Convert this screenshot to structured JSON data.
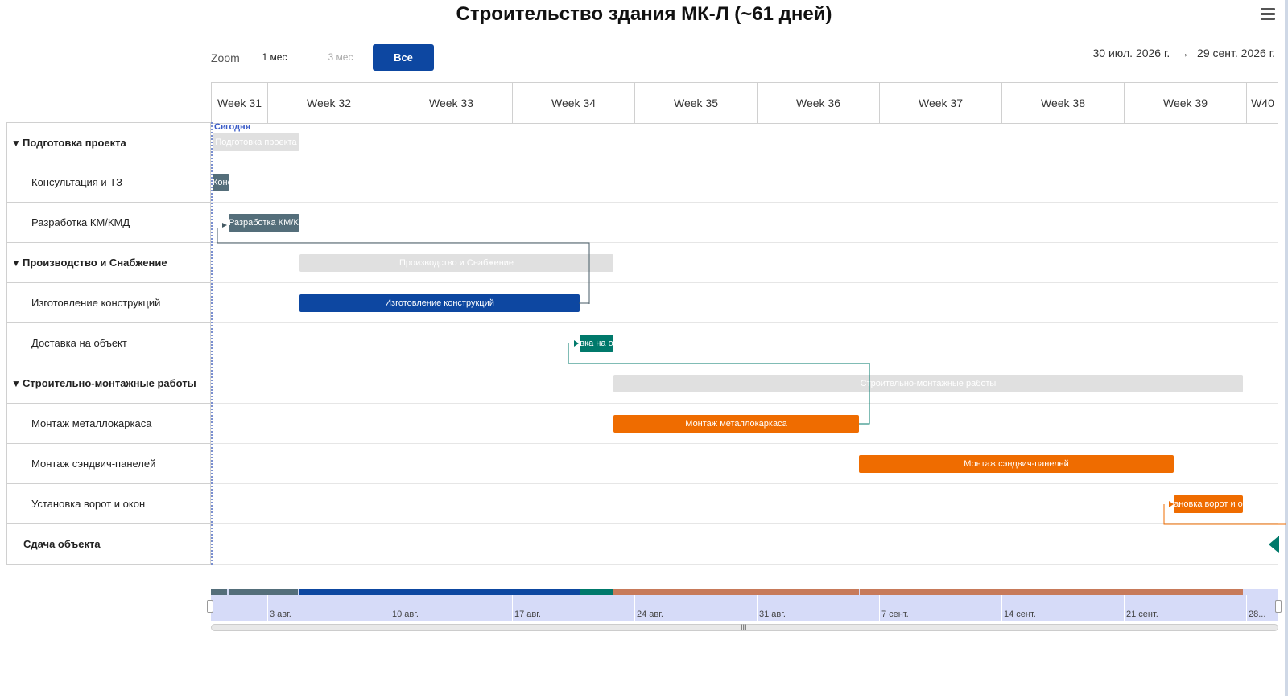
{
  "title": "Строительство здания МК-Л (~61 дней)",
  "menu_icon": "hamburger-menu-icon",
  "zoom": {
    "label": "Zoom",
    "options": [
      "1 мес",
      "3 мес",
      "Все"
    ],
    "selected": "Все"
  },
  "date_range": {
    "start": "30 июл. 2026 г.",
    "arrow": "→",
    "end": "29 сент. 2026 г."
  },
  "weeks": [
    "Week 31",
    "Week 32",
    "Week 33",
    "Week 34",
    "Week 35",
    "Week 36",
    "Week 37",
    "Week 38",
    "Week 39",
    "W40"
  ],
  "today_label": "Сегодня",
  "rows": [
    {
      "label": "Подготовка проекта",
      "kind": "group",
      "collapse_icon": "triangle-down-icon",
      "bar_label": "Подготовка проекта"
    },
    {
      "label": "Консультация и ТЗ",
      "kind": "task",
      "bar_label": "Конс"
    },
    {
      "label": "Разработка КМ/КМД",
      "kind": "task",
      "bar_label": "Разработка КМ/КМ"
    },
    {
      "label": "Производство и Снабжение",
      "kind": "group",
      "collapse_icon": "triangle-down-icon",
      "bar_label": "Производство и Снабжение"
    },
    {
      "label": "Изготовление конструкций",
      "kind": "task",
      "bar_label": "Изготовление конструкций"
    },
    {
      "label": "Доставка на объект",
      "kind": "task",
      "bar_label": "вка на о"
    },
    {
      "label": "Строительно-монтажные работы",
      "kind": "group",
      "collapse_icon": "triangle-down-icon",
      "bar_label": "Строительно-монтажные работы"
    },
    {
      "label": "Монтаж металлокаркаса",
      "kind": "task",
      "bar_label": "Монтаж металлокаркаса"
    },
    {
      "label": "Монтаж сэндвич-панелей",
      "kind": "task",
      "bar_label": "Монтаж сэндвич-панелей"
    },
    {
      "label": "Установка ворот и окон",
      "kind": "task",
      "bar_label": "ановка ворот и о"
    },
    {
      "label": "Сдача объекта",
      "kind": "milestone",
      "bar_label": ""
    }
  ],
  "colors": {
    "summary": "#e0e0e0",
    "prep": "#546e7a",
    "production": "#0d47a1",
    "delivery": "#00796b",
    "construction": "#ef6c00",
    "navigator_bg": "#d6dbf8",
    "accent": "#0d47a1"
  },
  "navigator": {
    "labels": [
      "3 авг.",
      "10 авг.",
      "17 авг.",
      "24 авг.",
      "31 авг.",
      "7 сент.",
      "14 сент.",
      "21 сент.",
      "28..."
    ],
    "grip": "III"
  }
}
